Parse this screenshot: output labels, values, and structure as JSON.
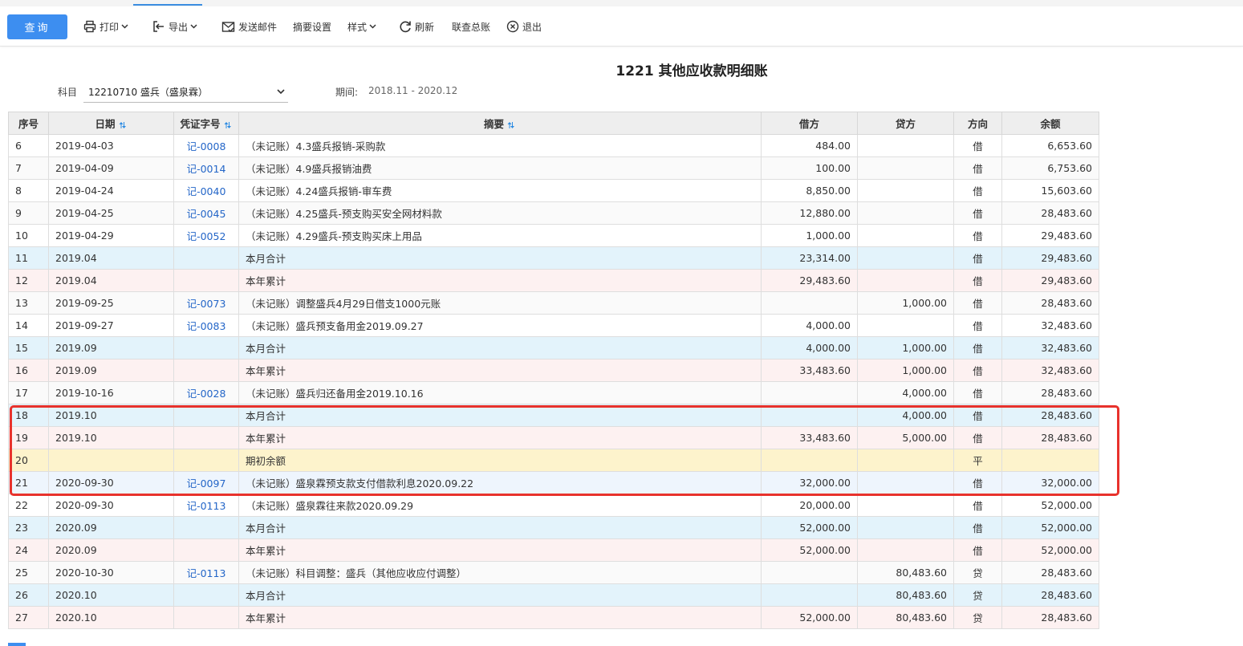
{
  "toolbar": {
    "query_label": "查询",
    "print_label": "打印",
    "export_label": "导出",
    "email_label": "发送邮件",
    "summary_settings_label": "摘要设置",
    "style_label": "样式",
    "refresh_label": "刷新",
    "linked_ledger_label": "联查总账",
    "exit_label": "退出"
  },
  "report": {
    "title": "1221 其他应收款明细账",
    "subject_label": "科目",
    "subject_value": "12210710 盛兵（盛泉霖）",
    "period_label": "期间:",
    "period_value": "2018.11 - 2020.12"
  },
  "colors": {
    "accent": "#3d8ef0",
    "link": "#2466c8",
    "month_row": "#e3f3fb",
    "year_row": "#fdf1f1",
    "opening_row": "#fdf3cc",
    "highlight_border": "#e8322c"
  },
  "table": {
    "headers": {
      "idx": "序号",
      "date": "日期",
      "voucher": "凭证字号",
      "summary": "摘要",
      "debit": "借方",
      "credit": "贷方",
      "direction": "方向",
      "balance": "余额"
    },
    "rows": [
      {
        "type": "normal",
        "idx": "6",
        "date": "2019-04-03",
        "voucher": "记-0008",
        "summary": "（未记账）4.3盛兵报销-采购款",
        "debit": "484.00",
        "credit": "",
        "direction": "借",
        "balance": "6,653.60"
      },
      {
        "type": "normal",
        "idx": "7",
        "date": "2019-04-09",
        "voucher": "记-0014",
        "summary": "（未记账）4.9盛兵报销油费",
        "debit": "100.00",
        "credit": "",
        "direction": "借",
        "balance": "6,753.60"
      },
      {
        "type": "normal",
        "idx": "8",
        "date": "2019-04-24",
        "voucher": "记-0040",
        "summary": "（未记账）4.24盛兵报销-审车费",
        "debit": "8,850.00",
        "credit": "",
        "direction": "借",
        "balance": "15,603.60"
      },
      {
        "type": "normal",
        "idx": "9",
        "date": "2019-04-25",
        "voucher": "记-0045",
        "summary": "（未记账）4.25盛兵-预支购买安全网材料款",
        "debit": "12,880.00",
        "credit": "",
        "direction": "借",
        "balance": "28,483.60"
      },
      {
        "type": "normal",
        "idx": "10",
        "date": "2019-04-29",
        "voucher": "记-0052",
        "summary": "（未记账）4.29盛兵-预支购买床上用品",
        "debit": "1,000.00",
        "credit": "",
        "direction": "借",
        "balance": "29,483.60"
      },
      {
        "type": "month",
        "idx": "11",
        "date": "2019.04",
        "voucher": "",
        "summary": "本月合计",
        "debit": "23,314.00",
        "credit": "",
        "direction": "借",
        "balance": "29,483.60"
      },
      {
        "type": "year",
        "idx": "12",
        "date": "2019.04",
        "voucher": "",
        "summary": "本年累计",
        "debit": "29,483.60",
        "credit": "",
        "direction": "借",
        "balance": "29,483.60"
      },
      {
        "type": "normal",
        "idx": "13",
        "date": "2019-09-25",
        "voucher": "记-0073",
        "summary": "（未记账）调整盛兵4月29日借支1000元账",
        "debit": "",
        "credit": "1,000.00",
        "direction": "借",
        "balance": "28,483.60"
      },
      {
        "type": "normal",
        "idx": "14",
        "date": "2019-09-27",
        "voucher": "记-0083",
        "summary": "（未记账）盛兵预支备用金2019.09.27",
        "debit": "4,000.00",
        "credit": "",
        "direction": "借",
        "balance": "32,483.60"
      },
      {
        "type": "month",
        "idx": "15",
        "date": "2019.09",
        "voucher": "",
        "summary": "本月合计",
        "debit": "4,000.00",
        "credit": "1,000.00",
        "direction": "借",
        "balance": "32,483.60"
      },
      {
        "type": "year",
        "idx": "16",
        "date": "2019.09",
        "voucher": "",
        "summary": "本年累计",
        "debit": "33,483.60",
        "credit": "1,000.00",
        "direction": "借",
        "balance": "32,483.60"
      },
      {
        "type": "normal",
        "idx": "17",
        "date": "2019-10-16",
        "voucher": "记-0028",
        "summary": "（未记账）盛兵归还备用金2019.10.16",
        "debit": "",
        "credit": "4,000.00",
        "direction": "借",
        "balance": "28,483.60"
      },
      {
        "type": "month",
        "idx": "18",
        "date": "2019.10",
        "voucher": "",
        "summary": "本月合计",
        "debit": "",
        "credit": "4,000.00",
        "direction": "借",
        "balance": "28,483.60"
      },
      {
        "type": "year",
        "idx": "19",
        "date": "2019.10",
        "voucher": "",
        "summary": "本年累计",
        "debit": "33,483.60",
        "credit": "5,000.00",
        "direction": "借",
        "balance": "28,483.60"
      },
      {
        "type": "opening",
        "idx": "20",
        "date": "",
        "voucher": "",
        "summary": "期初余额",
        "debit": "",
        "credit": "",
        "direction": "平",
        "balance": ""
      },
      {
        "type": "sel",
        "idx": "21",
        "date": "2020-09-30",
        "voucher": "记-0097",
        "summary": "（未记账）盛泉霖预支款支付借款利息2020.09.22",
        "debit": "32,000.00",
        "credit": "",
        "direction": "借",
        "balance": "32,000.00"
      },
      {
        "type": "normal",
        "idx": "22",
        "date": "2020-09-30",
        "voucher": "记-0113",
        "summary": "（未记账）盛泉霖往来款2020.09.29",
        "debit": "20,000.00",
        "credit": "",
        "direction": "借",
        "balance": "52,000.00"
      },
      {
        "type": "month",
        "idx": "23",
        "date": "2020.09",
        "voucher": "",
        "summary": "本月合计",
        "debit": "52,000.00",
        "credit": "",
        "direction": "借",
        "balance": "52,000.00"
      },
      {
        "type": "year",
        "idx": "24",
        "date": "2020.09",
        "voucher": "",
        "summary": "本年累计",
        "debit": "52,000.00",
        "credit": "",
        "direction": "借",
        "balance": "52,000.00"
      },
      {
        "type": "normal",
        "idx": "25",
        "date": "2020-10-30",
        "voucher": "记-0113",
        "summary": "（未记账）科目调整：盛兵（其他应收应付调整）",
        "debit": "",
        "credit": "80,483.60",
        "direction": "贷",
        "balance": "28,483.60"
      },
      {
        "type": "month",
        "idx": "26",
        "date": "2020.10",
        "voucher": "",
        "summary": "本月合计",
        "debit": "",
        "credit": "80,483.60",
        "direction": "贷",
        "balance": "28,483.60"
      },
      {
        "type": "year",
        "idx": "27",
        "date": "2020.10",
        "voucher": "",
        "summary": "本年累计",
        "debit": "52,000.00",
        "credit": "80,483.60",
        "direction": "贷",
        "balance": "28,483.60"
      }
    ]
  }
}
